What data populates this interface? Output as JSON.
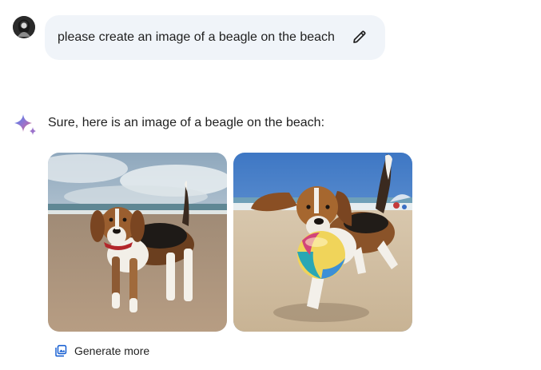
{
  "user_message": {
    "text": "please create an image of a beagle on the beach",
    "avatar_icon": "user-avatar",
    "edit_icon": "pencil-icon"
  },
  "response": {
    "assistant_icon": "sparkle-icon",
    "text": "Sure, here is an image of a beagle on the beach:",
    "images": [
      {
        "subject": "beagle standing on sandy beach with ocean and cloudy sky"
      },
      {
        "subject": "beagle running on beach carrying a colorful ball"
      }
    ],
    "generate_more": {
      "label": "Generate more",
      "icon": "image-stack-icon"
    }
  },
  "colors": {
    "bubble_bg": "#f0f4f9",
    "text": "#1f1f1f",
    "accent_blue": "#4285f4"
  }
}
